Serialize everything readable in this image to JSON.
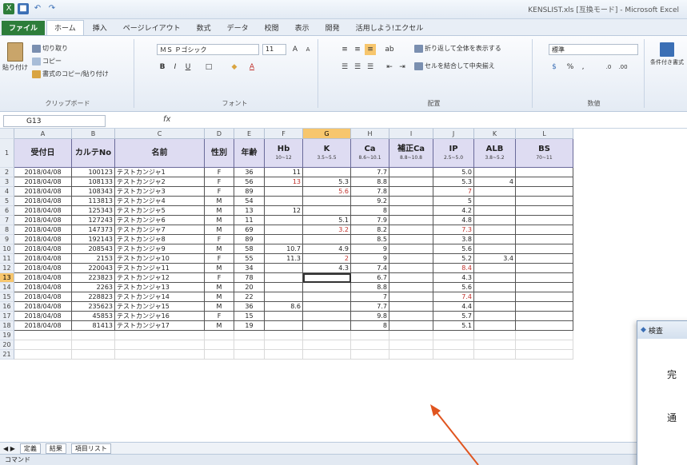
{
  "window_title": "KENSLIST.xls [互換モード] - Microsoft Excel",
  "qat_icons": [
    "excel-icon",
    "save-icon",
    "undo-icon",
    "redo-icon"
  ],
  "tabs": [
    "ファイル",
    "ホーム",
    "挿入",
    "ページレイアウト",
    "数式",
    "データ",
    "校閲",
    "表示",
    "開発",
    "活用しよう!エクセル"
  ],
  "ribbon": {
    "paste": "貼り付け",
    "cut": "切り取り",
    "copy": "コピー",
    "format_painter": "書式のコピー/貼り付け",
    "clipboard": "クリップボード",
    "font_name": "ＭＳ Ｐゴシック",
    "font_size": "11",
    "font_group": "フォント",
    "wrap_text": "折り返して全体を表示する",
    "merge_center": "セルを結合して中央揃え",
    "alignment_group": "配置",
    "number_format": "標準",
    "number_group": "数値",
    "conditional_format": "条件付き書式"
  },
  "name_box": "G13",
  "fx_label": "fx",
  "columns": [
    "A",
    "B",
    "C",
    "D",
    "E",
    "F",
    "G",
    "H",
    "I",
    "J",
    "K",
    "L"
  ],
  "selected_column": "G",
  "header_row": [
    {
      "label": "受付日",
      "sub": ""
    },
    {
      "label": "カルテNo",
      "sub": ""
    },
    {
      "label": "名前",
      "sub": ""
    },
    {
      "label": "性別",
      "sub": ""
    },
    {
      "label": "年齢",
      "sub": ""
    },
    {
      "label": "Hb",
      "sub": "10~12"
    },
    {
      "label": "K",
      "sub": "3.5~5.5"
    },
    {
      "label": "Ca",
      "sub": "8.6~10.1"
    },
    {
      "label": "補正Ca",
      "sub": "8.8~10.8"
    },
    {
      "label": "IP",
      "sub": "2.5~5.0"
    },
    {
      "label": "ALB",
      "sub": "3.8~5.2"
    },
    {
      "label": "BS",
      "sub": "70~11"
    }
  ],
  "rows": [
    {
      "n": "2",
      "date": "2018/04/08",
      "no": "100123",
      "name": "テストカンジャ1",
      "sex": "F",
      "age": "36",
      "hb": "11",
      "k": "",
      "ca": "7.7",
      "cca": "",
      "ip": "5.0",
      "alb": "",
      "bs": "",
      "red": []
    },
    {
      "n": "3",
      "date": "2018/04/08",
      "no": "108133",
      "name": "テストカンジャ2",
      "sex": "F",
      "age": "56",
      "hb": "13",
      "k": "5.3",
      "ca": "8.8",
      "cca": "",
      "ip": "5.3",
      "alb": "4",
      "bs": "",
      "red": [
        "hb"
      ]
    },
    {
      "n": "4",
      "date": "2018/04/08",
      "no": "108343",
      "name": "テストカンジャ3",
      "sex": "F",
      "age": "89",
      "hb": "",
      "k": "5.6",
      "ca": "7.8",
      "cca": "",
      "ip": "7",
      "alb": "",
      "bs": "",
      "red": [
        "k",
        "ip"
      ]
    },
    {
      "n": "5",
      "date": "2018/04/08",
      "no": "113813",
      "name": "テストカンジャ4",
      "sex": "M",
      "age": "54",
      "hb": "",
      "k": "",
      "ca": "9.2",
      "cca": "",
      "ip": "5",
      "alb": "",
      "bs": "",
      "red": []
    },
    {
      "n": "6",
      "date": "2018/04/08",
      "no": "125343",
      "name": "テストカンジャ5",
      "sex": "M",
      "age": "13",
      "hb": "12",
      "k": "",
      "ca": "8",
      "cca": "",
      "ip": "4.2",
      "alb": "",
      "bs": "",
      "red": []
    },
    {
      "n": "7",
      "date": "2018/04/08",
      "no": "127243",
      "name": "テストカンジャ6",
      "sex": "M",
      "age": "11",
      "hb": "",
      "k": "5.1",
      "ca": "7.9",
      "cca": "",
      "ip": "4.8",
      "alb": "",
      "bs": "",
      "red": []
    },
    {
      "n": "8",
      "date": "2018/04/08",
      "no": "147373",
      "name": "テストカンジャ7",
      "sex": "M",
      "age": "69",
      "hb": "",
      "k": "3.2",
      "ca": "8.2",
      "cca": "",
      "ip": "7.3",
      "alb": "",
      "bs": "",
      "red": [
        "k",
        "ip"
      ]
    },
    {
      "n": "9",
      "date": "2018/04/08",
      "no": "192143",
      "name": "テストカンジャ8",
      "sex": "F",
      "age": "89",
      "hb": "",
      "k": "",
      "ca": "8.5",
      "cca": "",
      "ip": "3.8",
      "alb": "",
      "bs": "",
      "red": []
    },
    {
      "n": "10",
      "date": "2018/04/08",
      "no": "208543",
      "name": "テストカンジャ9",
      "sex": "M",
      "age": "58",
      "hb": "10.7",
      "k": "4.9",
      "ca": "9",
      "cca": "",
      "ip": "5.6",
      "alb": "",
      "bs": "",
      "red": []
    },
    {
      "n": "11",
      "date": "2018/04/08",
      "no": "2153",
      "name": "テストカンジャ10",
      "sex": "F",
      "age": "55",
      "hb": "11.3",
      "k": "2",
      "ca": "9",
      "cca": "",
      "ip": "5.2",
      "alb": "3.4",
      "bs": "",
      "red": [
        "k"
      ]
    },
    {
      "n": "12",
      "date": "2018/04/08",
      "no": "220043",
      "name": "テストカンジャ11",
      "sex": "M",
      "age": "34",
      "hb": "",
      "k": "4.3",
      "ca": "7.4",
      "cca": "",
      "ip": "8.4",
      "alb": "",
      "bs": "",
      "red": [
        "ip"
      ]
    },
    {
      "n": "13",
      "date": "2018/04/08",
      "no": "223823",
      "name": "テストカンジャ12",
      "sex": "F",
      "age": "78",
      "hb": "",
      "k": "",
      "ca": "6.7",
      "cca": "",
      "ip": "4.3",
      "alb": "",
      "bs": "",
      "red": []
    },
    {
      "n": "14",
      "date": "2018/04/08",
      "no": "2263",
      "name": "テストカンジャ13",
      "sex": "M",
      "age": "20",
      "hb": "",
      "k": "",
      "ca": "8.8",
      "cca": "",
      "ip": "5.6",
      "alb": "",
      "bs": "",
      "red": []
    },
    {
      "n": "15",
      "date": "2018/04/08",
      "no": "228823",
      "name": "テストカンジャ14",
      "sex": "M",
      "age": "22",
      "hb": "",
      "k": "",
      "ca": "7",
      "cca": "",
      "ip": "7.4",
      "alb": "",
      "bs": "",
      "red": [
        "ip"
      ]
    },
    {
      "n": "16",
      "date": "2018/04/08",
      "no": "235623",
      "name": "テストカンジャ15",
      "sex": "M",
      "age": "36",
      "hb": "8.6",
      "k": "",
      "ca": "7.7",
      "cca": "",
      "ip": "4.4",
      "alb": "",
      "bs": "",
      "red": []
    },
    {
      "n": "17",
      "date": "2018/04/08",
      "no": "45853",
      "name": "テストカンジャ16",
      "sex": "F",
      "age": "15",
      "hb": "",
      "k": "",
      "ca": "9.8",
      "cca": "",
      "ip": "5.7",
      "alb": "",
      "bs": "",
      "red": []
    },
    {
      "n": "18",
      "date": "2018/04/08",
      "no": "81413",
      "name": "テストカンジャ17",
      "sex": "M",
      "age": "19",
      "hb": "",
      "k": "",
      "ca": "8",
      "cca": "",
      "ip": "5.1",
      "alb": "",
      "bs": "",
      "red": []
    }
  ],
  "empty_rows": [
    "19",
    "20",
    "21"
  ],
  "selected_row": "13",
  "sheet_tabs": [
    "定義",
    "結果",
    "項目リスト"
  ],
  "status": "コマンド",
  "dialog": {
    "title": "検査",
    "text1": "完",
    "text2": "通"
  },
  "colors": {
    "red": "#c0302a",
    "header_fill": "#dedcf2",
    "file_tab": "#2d7d3a",
    "selection": "#f7c66d",
    "arrow": "#e0551f"
  }
}
